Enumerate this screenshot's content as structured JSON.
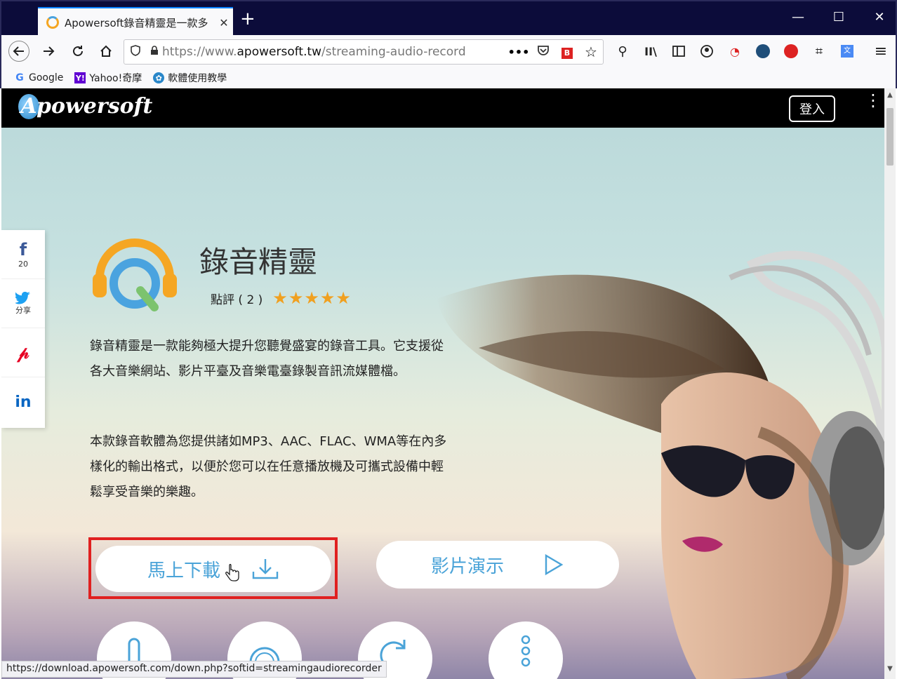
{
  "browser": {
    "tab_title": "Apowersoft錄音精靈是一款多",
    "tab_close": "✕",
    "new_tab": "+",
    "window_controls": {
      "minimize": "—",
      "maximize": "☐",
      "close": "✕"
    },
    "url": {
      "prefix": "https://www.",
      "domain": "apowersoft.tw",
      "path": "/streaming-audio-recorde"
    },
    "bookmarks": [
      {
        "label": "Google",
        "icon": "google-icon",
        "icon_text": "G",
        "color": "#4285f4"
      },
      {
        "label": "Yahoo!奇摩",
        "icon": "yahoo-icon",
        "icon_text": "Y!",
        "color": "#6001d2"
      },
      {
        "label": "軟體使用教學",
        "icon": "gear-icon",
        "icon_text": "✿",
        "color": "#2a87c9"
      }
    ],
    "status_url": "https://download.apowersoft.com/down.php?softid=streamingaudiorecorder"
  },
  "site": {
    "logo": "powersoft",
    "logo_initial": "A",
    "login_label": "登入",
    "share": [
      {
        "icon": "facebook-icon",
        "glyph": "f",
        "sub": "20",
        "color": "#3b5998"
      },
      {
        "icon": "twitter-icon",
        "glyph": "🐦",
        "sub": "分享",
        "color": "#1da1f2"
      },
      {
        "icon": "pinterest-icon",
        "glyph": "P",
        "sub": "",
        "color": "#e60023"
      },
      {
        "icon": "linkedin-icon",
        "glyph": "in",
        "sub": "",
        "color": "#0a66c2"
      }
    ],
    "product": {
      "title": "錄音精靈",
      "rating_label": "點評 ( 2 )",
      "stars": 5,
      "stars_text": "★★★★★",
      "paragraphs": [
        "錄音精靈是一款能夠極大提升您聽覺盛宴的錄音工具。它支援從各大音樂網站、影片平臺及音樂電臺錄製音訊流媒體檔。",
        "本款錄音軟體為您提供諸如MP3、AAC、FLAC、WMA等在內多樣化的輸出格式，以便於您可以在任意播放機及可攜式設備中輕鬆享受音樂的樂趣。"
      ],
      "download_label": "馬上下載",
      "demo_label": "影片演示"
    },
    "feature_icons": [
      "plug-icon",
      "disc-icon",
      "refresh-icon",
      "more-icon"
    ],
    "colors": {
      "accent": "#4aa3d8",
      "star": "#f0a020",
      "highlight": "#e02020"
    }
  }
}
